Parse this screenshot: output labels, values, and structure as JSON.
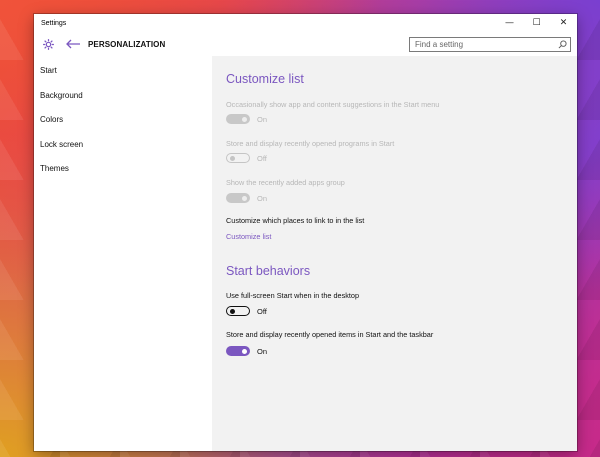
{
  "window": {
    "title": "Settings",
    "minimize_glyph": "—",
    "maximize_glyph": "☐",
    "close_glyph": "✕"
  },
  "header": {
    "title": "PERSONALIZATION",
    "search_placeholder": "Find a setting"
  },
  "sidebar": {
    "items": [
      {
        "label": "Start"
      },
      {
        "label": "Background"
      },
      {
        "label": "Colors"
      },
      {
        "label": "Lock screen"
      },
      {
        "label": "Themes"
      }
    ]
  },
  "content": {
    "customize_title": "Customize list",
    "suggestions": {
      "label": "Occasionally show app and content suggestions in the Start menu",
      "state": "On"
    },
    "recent_programs": {
      "label": "Store and display recently opened programs in Start",
      "state": "Off"
    },
    "recent_apps": {
      "label": "Show the recently added apps group",
      "state": "On"
    },
    "places_label": "Customize which places to link to in the list",
    "customize_link": "Customize list",
    "behaviors_title": "Start behaviors",
    "fullscreen": {
      "label": "Use full-screen Start when in the desktop",
      "state": "Off"
    },
    "recent_items": {
      "label": "Store and display recently opened items in Start and the taskbar",
      "state": "On"
    }
  },
  "colors": {
    "accent": "#7b57c0",
    "disabled_text": "#b7b7b7",
    "content_bg": "#f2f2f2"
  }
}
